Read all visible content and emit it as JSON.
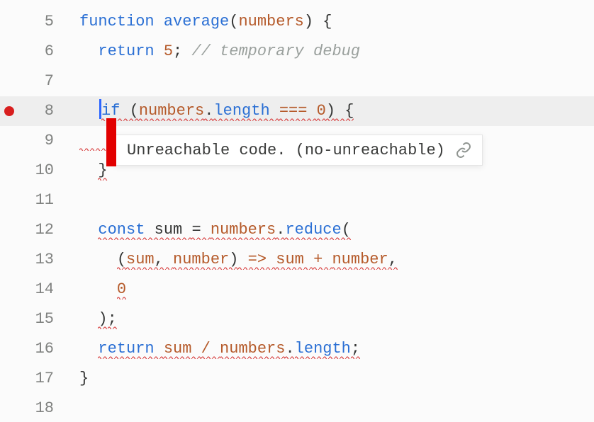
{
  "gutter": {
    "line_numbers": [
      "5",
      "6",
      "7",
      "8",
      "9",
      "10",
      "11",
      "12",
      "13",
      "14",
      "15",
      "16",
      "17",
      "18"
    ],
    "breakpoint_line": "8"
  },
  "tooltip": {
    "message": "Unreachable code. (no-unreachable)",
    "link_icon": "link-icon"
  },
  "code": {
    "l5": {
      "kw": "function ",
      "fn": "average",
      "lp": "(",
      "arg": "numbers",
      "rp": ")",
      "brace": " {"
    },
    "l6": {
      "kw": "return ",
      "num": "5",
      "semi": ";",
      "cmnt": " // temporary debug"
    },
    "l7": {
      "blank": ""
    },
    "l8": {
      "kw": "if ",
      "lp": "(",
      "obj": "numbers",
      "dot": ".",
      "prop": "length",
      "sp": " ",
      "cmp": "=== ",
      "zero": "0",
      "rp": ")",
      "brace": " {"
    },
    "l9": {
      "hidden": "    "
    },
    "l10": {
      "brace": "}"
    },
    "l11": {
      "blank": ""
    },
    "l12": {
      "kw": "const ",
      "name": "sum ",
      "eq": "= ",
      "obj": "numbers",
      "dot": ".",
      "fn": "reduce",
      "lp": "("
    },
    "l13": {
      "lp": "(",
      "a": "sum",
      "c": ", ",
      "b": "number",
      "rp": ")",
      "arrow": " => ",
      "x": "sum ",
      "plus": "+ ",
      "y": "number",
      "comma": ","
    },
    "l14": {
      "zero": "0"
    },
    "l15": {
      "rp": ")",
      "semi": ";"
    },
    "l16": {
      "kw": "return ",
      "a": "sum ",
      "div": "/ ",
      "obj": "numbers",
      "dot": ".",
      "prop": "length",
      "semi": ";"
    },
    "l17": {
      "brace": "}"
    },
    "l18": {
      "blank": ""
    }
  }
}
